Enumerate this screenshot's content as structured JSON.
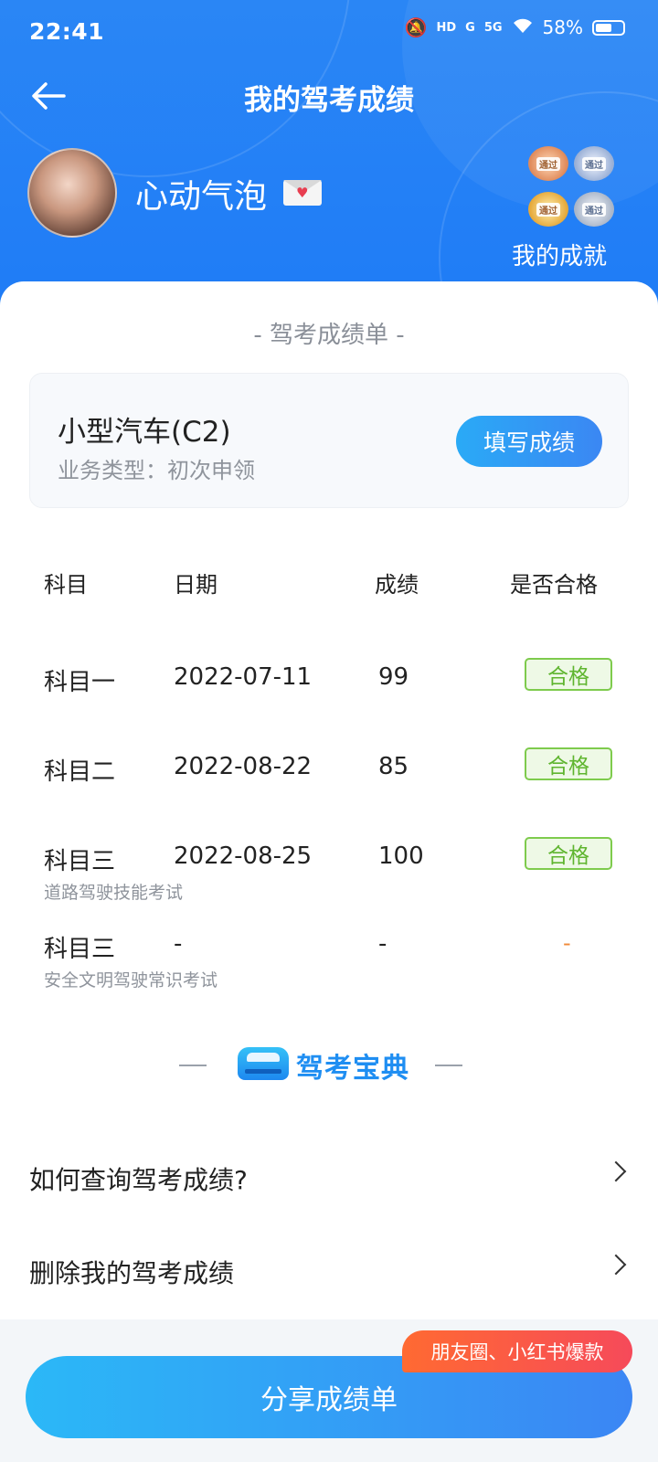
{
  "status_bar": {
    "time": "22:41",
    "network_hd": "HD",
    "signal_1": "G",
    "signal_2": "5G",
    "battery": "58%"
  },
  "header": {
    "title": "我的驾考成绩",
    "username": "心动气泡",
    "badge_text": "通过",
    "achievement_label": "我的成就"
  },
  "sheet": {
    "title": "- 驾考成绩单 -",
    "license_name": "小型汽车(C2)",
    "license_type": "业务类型：初次申领",
    "fill_button": "填写成绩"
  },
  "table": {
    "headers": [
      "科目",
      "日期",
      "成绩",
      "是否合格"
    ],
    "rows": [
      {
        "subject": "科目一",
        "desc": "",
        "date": "2022-07-11",
        "score": "99",
        "result": "合格"
      },
      {
        "subject": "科目二",
        "desc": "",
        "date": "2022-08-22",
        "score": "85",
        "result": "合格"
      },
      {
        "subject": "科目三",
        "desc": "道路驾驶技能考试",
        "date": "2022-08-25",
        "score": "100",
        "result": "合格"
      },
      {
        "subject": "科目三",
        "desc": "安全文明驾驶常识考试",
        "date": "-",
        "score": "-",
        "result": "-"
      }
    ]
  },
  "brand": {
    "name": "驾考宝典"
  },
  "faq": [
    {
      "label": "如何查询驾考成绩?"
    },
    {
      "label": "删除我的驾考成绩"
    }
  ],
  "share": {
    "button": "分享成绩单",
    "promo": "朋友圈、小红书爆款"
  },
  "colors": {
    "primary": "#1f7cf6",
    "pass_green": "#5fb52f",
    "pending_orange": "#f08a3a",
    "promo_red": "#f64a5a"
  }
}
